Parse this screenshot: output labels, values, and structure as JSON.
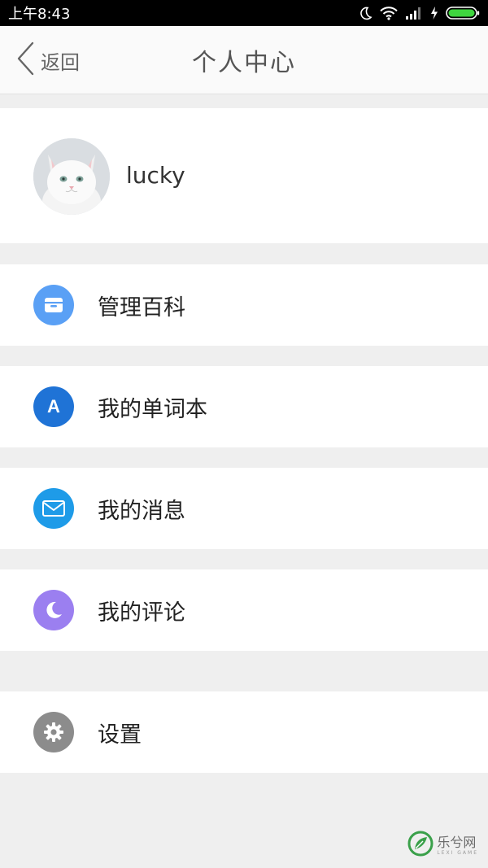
{
  "status_bar": {
    "time": "上午8:43"
  },
  "nav": {
    "back_label": "返回",
    "title": "个人中心"
  },
  "profile": {
    "username": "lucky"
  },
  "menu": [
    {
      "label": "管理百科",
      "icon": "archive-box-icon",
      "color": "#5aa0f5"
    },
    {
      "label": "我的单词本",
      "icon": "letter-a-icon",
      "color": "#1f73d6"
    },
    {
      "label": "我的消息",
      "icon": "envelope-icon",
      "color": "#1e9be8"
    },
    {
      "label": "我的评论",
      "icon": "crescent-moon-icon",
      "color": "#9b7ff0"
    },
    {
      "label": "设置",
      "icon": "gear-icon",
      "color": "#8c8c8c"
    }
  ],
  "menu_icon_text": {
    "word_book_letter": "A"
  },
  "watermark": {
    "text": "乐兮网",
    "sub": "LEXI GAME"
  },
  "colors": {
    "background": "#efefef",
    "card": "#ffffff",
    "status_bar": "#000000",
    "battery": "#3fd63f"
  }
}
